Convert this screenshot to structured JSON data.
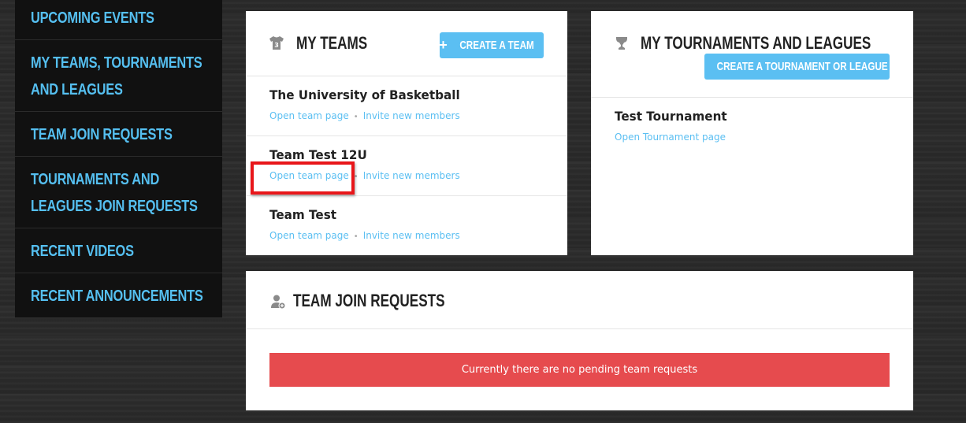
{
  "sidebar": {
    "items": [
      {
        "label_lines": [
          "UPCOMING EVENTS"
        ]
      },
      {
        "label_lines": [
          "MY TEAMS, TOURNAMENTS",
          "AND LEAGUES"
        ]
      },
      {
        "label_lines": [
          "TEAM JOIN REQUESTS"
        ]
      },
      {
        "label_lines": [
          "TOURNAMENTS AND",
          "LEAGUES JOIN REQUESTS"
        ]
      },
      {
        "label_lines": [
          "RECENT VIDEOS"
        ]
      },
      {
        "label_lines": [
          "RECENT ANNOUNCEMENTS"
        ]
      }
    ]
  },
  "my_teams": {
    "title": "MY TEAMS",
    "icon": "jersey-icon",
    "create_button": {
      "plus": "+",
      "label": "CREATE A TEAM"
    },
    "teams": [
      {
        "name": "The University of Basketball",
        "open_link": "Open team page",
        "invite_link": "Invite new members"
      },
      {
        "name": "Team Test 12U",
        "open_link": "Open team page",
        "invite_link": "Invite new members"
      },
      {
        "name": "Team Test",
        "open_link": "Open team page",
        "invite_link": "Invite new members"
      }
    ],
    "separator": "•"
  },
  "tournaments": {
    "title": "MY TOURNAMENTS AND LEAGUES",
    "icon": "trophy-icon",
    "create_button": {
      "plus": "+",
      "label": "CREATE A TOURNAMENT OR LEAGUE"
    },
    "items": [
      {
        "name": "Test Tournament",
        "open_link": "Open Tournament page"
      }
    ]
  },
  "join_requests": {
    "title": "TEAM JOIN REQUESTS",
    "icon": "add-user-icon",
    "empty_message": "Currently there are no pending team requests"
  },
  "colors": {
    "accent": "#5bbff2",
    "sidebar_bg": "#111111",
    "alert": "#e64b4e",
    "annotation": "#e8161a"
  }
}
